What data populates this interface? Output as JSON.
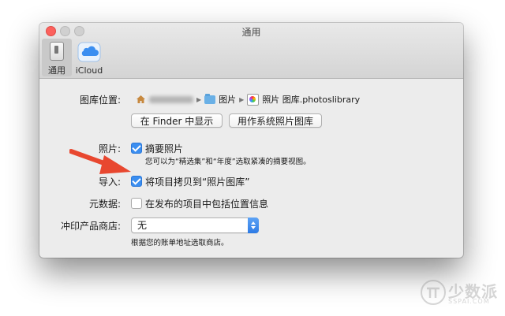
{
  "window": {
    "title": "通用"
  },
  "toolbar": {
    "general_label": "通用",
    "icloud_label": "iCloud"
  },
  "library": {
    "label": "图库位置:",
    "path": {
      "folder": "图片",
      "library": "照片 图库.photoslibrary"
    },
    "show_in_finder_label": "在 Finder 中显示",
    "use_as_system_label": "用作系统照片图库"
  },
  "photos": {
    "label": "照片:",
    "summarize_label": "摘要照片",
    "summarize_checked": true,
    "summarize_note": "您可以为“精选集”和“年度”选取紧凑的摘要视图。"
  },
  "import": {
    "label": "导入:",
    "copy_label": "将项目拷贝到“照片图库”",
    "copy_checked": true
  },
  "metadata": {
    "label": "元数据:",
    "location_label": "在发布的项目中包括位置信息",
    "location_checked": false
  },
  "print_store": {
    "label": "冲印产品商店:",
    "selected": "无",
    "note": "根据您的账单地址选取商店。"
  },
  "watermark": {
    "text": "少数派",
    "sub": "SSPAI.COM"
  },
  "colors": {
    "accent": "#3b8ef0",
    "annotation_arrow": "#e8472f",
    "close": "#fc615d"
  },
  "icons": [
    "switch-icon",
    "cloud-icon",
    "home-icon",
    "folder-icon",
    "library-icon",
    "chevron-right-icon",
    "checkmark-icon",
    "updown-arrows-icon",
    "arrow-annotation-icon"
  ]
}
